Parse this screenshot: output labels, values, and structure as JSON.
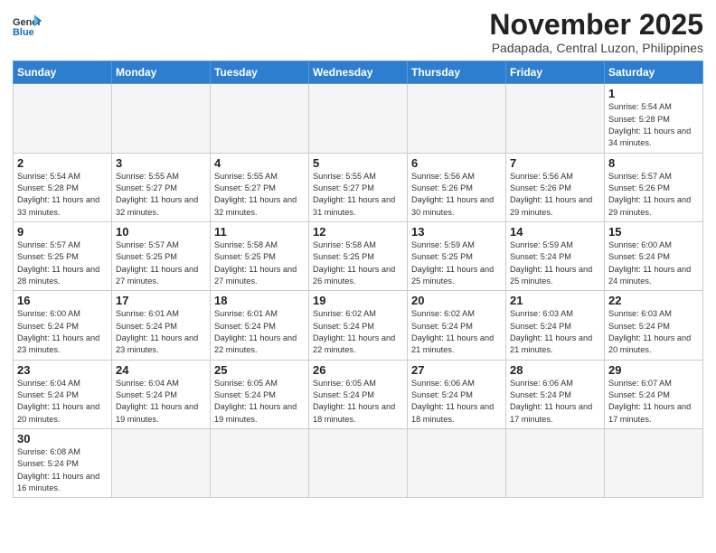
{
  "header": {
    "logo_general": "General",
    "logo_blue": "Blue",
    "month_title": "November 2025",
    "subtitle": "Padapada, Central Luzon, Philippines"
  },
  "weekdays": [
    "Sunday",
    "Monday",
    "Tuesday",
    "Wednesday",
    "Thursday",
    "Friday",
    "Saturday"
  ],
  "days": [
    {
      "num": "",
      "info": "",
      "empty": true
    },
    {
      "num": "",
      "info": "",
      "empty": true
    },
    {
      "num": "",
      "info": "",
      "empty": true
    },
    {
      "num": "",
      "info": "",
      "empty": true
    },
    {
      "num": "",
      "info": "",
      "empty": true
    },
    {
      "num": "",
      "info": "",
      "empty": true
    },
    {
      "num": "1",
      "info": "Sunrise: 5:54 AM\nSunset: 5:28 PM\nDaylight: 11 hours\nand 34 minutes.",
      "empty": false
    },
    {
      "num": "2",
      "info": "Sunrise: 5:54 AM\nSunset: 5:28 PM\nDaylight: 11 hours\nand 33 minutes.",
      "empty": false
    },
    {
      "num": "3",
      "info": "Sunrise: 5:55 AM\nSunset: 5:27 PM\nDaylight: 11 hours\nand 32 minutes.",
      "empty": false
    },
    {
      "num": "4",
      "info": "Sunrise: 5:55 AM\nSunset: 5:27 PM\nDaylight: 11 hours\nand 32 minutes.",
      "empty": false
    },
    {
      "num": "5",
      "info": "Sunrise: 5:55 AM\nSunset: 5:27 PM\nDaylight: 11 hours\nand 31 minutes.",
      "empty": false
    },
    {
      "num": "6",
      "info": "Sunrise: 5:56 AM\nSunset: 5:26 PM\nDaylight: 11 hours\nand 30 minutes.",
      "empty": false
    },
    {
      "num": "7",
      "info": "Sunrise: 5:56 AM\nSunset: 5:26 PM\nDaylight: 11 hours\nand 29 minutes.",
      "empty": false
    },
    {
      "num": "8",
      "info": "Sunrise: 5:57 AM\nSunset: 5:26 PM\nDaylight: 11 hours\nand 29 minutes.",
      "empty": false
    },
    {
      "num": "9",
      "info": "Sunrise: 5:57 AM\nSunset: 5:25 PM\nDaylight: 11 hours\nand 28 minutes.",
      "empty": false
    },
    {
      "num": "10",
      "info": "Sunrise: 5:57 AM\nSunset: 5:25 PM\nDaylight: 11 hours\nand 27 minutes.",
      "empty": false
    },
    {
      "num": "11",
      "info": "Sunrise: 5:58 AM\nSunset: 5:25 PM\nDaylight: 11 hours\nand 27 minutes.",
      "empty": false
    },
    {
      "num": "12",
      "info": "Sunrise: 5:58 AM\nSunset: 5:25 PM\nDaylight: 11 hours\nand 26 minutes.",
      "empty": false
    },
    {
      "num": "13",
      "info": "Sunrise: 5:59 AM\nSunset: 5:25 PM\nDaylight: 11 hours\nand 25 minutes.",
      "empty": false
    },
    {
      "num": "14",
      "info": "Sunrise: 5:59 AM\nSunset: 5:24 PM\nDaylight: 11 hours\nand 25 minutes.",
      "empty": false
    },
    {
      "num": "15",
      "info": "Sunrise: 6:00 AM\nSunset: 5:24 PM\nDaylight: 11 hours\nand 24 minutes.",
      "empty": false
    },
    {
      "num": "16",
      "info": "Sunrise: 6:00 AM\nSunset: 5:24 PM\nDaylight: 11 hours\nand 23 minutes.",
      "empty": false
    },
    {
      "num": "17",
      "info": "Sunrise: 6:01 AM\nSunset: 5:24 PM\nDaylight: 11 hours\nand 23 minutes.",
      "empty": false
    },
    {
      "num": "18",
      "info": "Sunrise: 6:01 AM\nSunset: 5:24 PM\nDaylight: 11 hours\nand 22 minutes.",
      "empty": false
    },
    {
      "num": "19",
      "info": "Sunrise: 6:02 AM\nSunset: 5:24 PM\nDaylight: 11 hours\nand 22 minutes.",
      "empty": false
    },
    {
      "num": "20",
      "info": "Sunrise: 6:02 AM\nSunset: 5:24 PM\nDaylight: 11 hours\nand 21 minutes.",
      "empty": false
    },
    {
      "num": "21",
      "info": "Sunrise: 6:03 AM\nSunset: 5:24 PM\nDaylight: 11 hours\nand 21 minutes.",
      "empty": false
    },
    {
      "num": "22",
      "info": "Sunrise: 6:03 AM\nSunset: 5:24 PM\nDaylight: 11 hours\nand 20 minutes.",
      "empty": false
    },
    {
      "num": "23",
      "info": "Sunrise: 6:04 AM\nSunset: 5:24 PM\nDaylight: 11 hours\nand 20 minutes.",
      "empty": false
    },
    {
      "num": "24",
      "info": "Sunrise: 6:04 AM\nSunset: 5:24 PM\nDaylight: 11 hours\nand 19 minutes.",
      "empty": false
    },
    {
      "num": "25",
      "info": "Sunrise: 6:05 AM\nSunset: 5:24 PM\nDaylight: 11 hours\nand 19 minutes.",
      "empty": false
    },
    {
      "num": "26",
      "info": "Sunrise: 6:05 AM\nSunset: 5:24 PM\nDaylight: 11 hours\nand 18 minutes.",
      "empty": false
    },
    {
      "num": "27",
      "info": "Sunrise: 6:06 AM\nSunset: 5:24 PM\nDaylight: 11 hours\nand 18 minutes.",
      "empty": false
    },
    {
      "num": "28",
      "info": "Sunrise: 6:06 AM\nSunset: 5:24 PM\nDaylight: 11 hours\nand 17 minutes.",
      "empty": false
    },
    {
      "num": "29",
      "info": "Sunrise: 6:07 AM\nSunset: 5:24 PM\nDaylight: 11 hours\nand 17 minutes.",
      "empty": false
    },
    {
      "num": "30",
      "info": "Sunrise: 6:08 AM\nSunset: 5:24 PM\nDaylight: 11 hours\nand 16 minutes.",
      "empty": false
    },
    {
      "num": "",
      "info": "",
      "empty": true
    },
    {
      "num": "",
      "info": "",
      "empty": true
    },
    {
      "num": "",
      "info": "",
      "empty": true
    },
    {
      "num": "",
      "info": "",
      "empty": true
    },
    {
      "num": "",
      "info": "",
      "empty": true
    },
    {
      "num": "",
      "info": "",
      "empty": true
    }
  ]
}
